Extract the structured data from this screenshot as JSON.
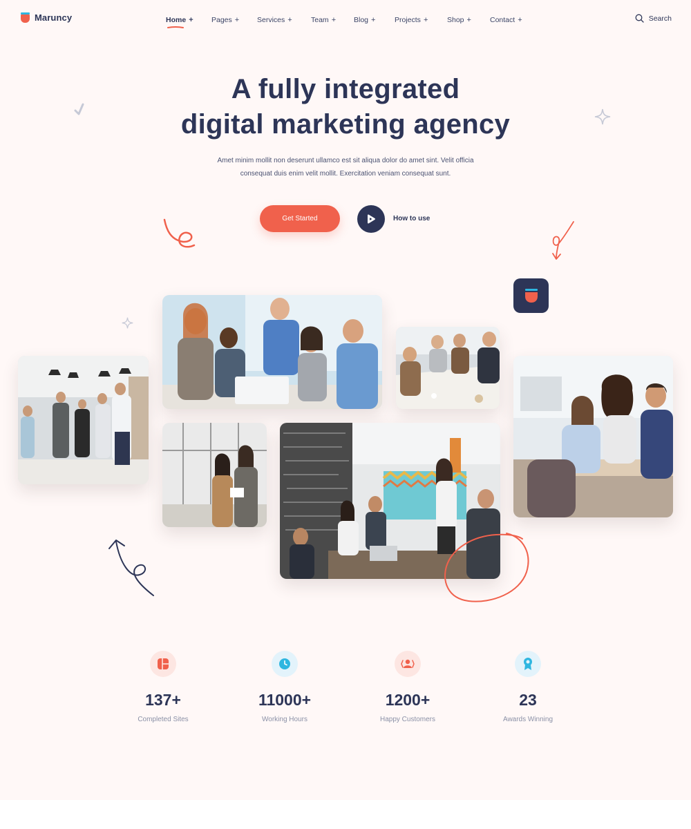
{
  "brand": {
    "name": "Maruncy",
    "colors": {
      "accent": "#f0614c",
      "navy": "#2d3557",
      "cyan": "#2fb6e0",
      "background": "#fff8f7"
    }
  },
  "nav": {
    "items": [
      {
        "label": "Home",
        "active": true
      },
      {
        "label": "Pages"
      },
      {
        "label": "Services"
      },
      {
        "label": "Team"
      },
      {
        "label": "Blog"
      },
      {
        "label": "Projects"
      },
      {
        "label": "Shop"
      },
      {
        "label": "Contact"
      }
    ],
    "plus": "+",
    "search_label": "Search"
  },
  "hero": {
    "title_line1": "A fully integrated",
    "title_line2": "digital marketing agency",
    "subtitle_line1": "Amet minim mollit non deserunt ullamco est sit aliqua dolor do amet sint. Velit officia",
    "subtitle_line2": "consequat duis enim velit mollit. Exercitation veniam consequat sunt.",
    "cta_label": "Get Started",
    "secondary_label": "How to use"
  },
  "stats": [
    {
      "value": "137+",
      "label": "Completed Sites",
      "icon": "grid-icon",
      "tint": "#fde6e2",
      "color": "#f0614c"
    },
    {
      "value": "11000+",
      "label": "Working Hours",
      "icon": "clock-icon",
      "tint": "#e3f3fb",
      "color": "#2fb6e0"
    },
    {
      "value": "1200+",
      "label": "Happy Customers",
      "icon": "customers-icon",
      "tint": "#fde6e2",
      "color": "#f0614c"
    },
    {
      "value": "23",
      "label": "Awards Winning",
      "icon": "award-icon",
      "tint": "#e3f3fb",
      "color": "#2fb6e0"
    }
  ]
}
